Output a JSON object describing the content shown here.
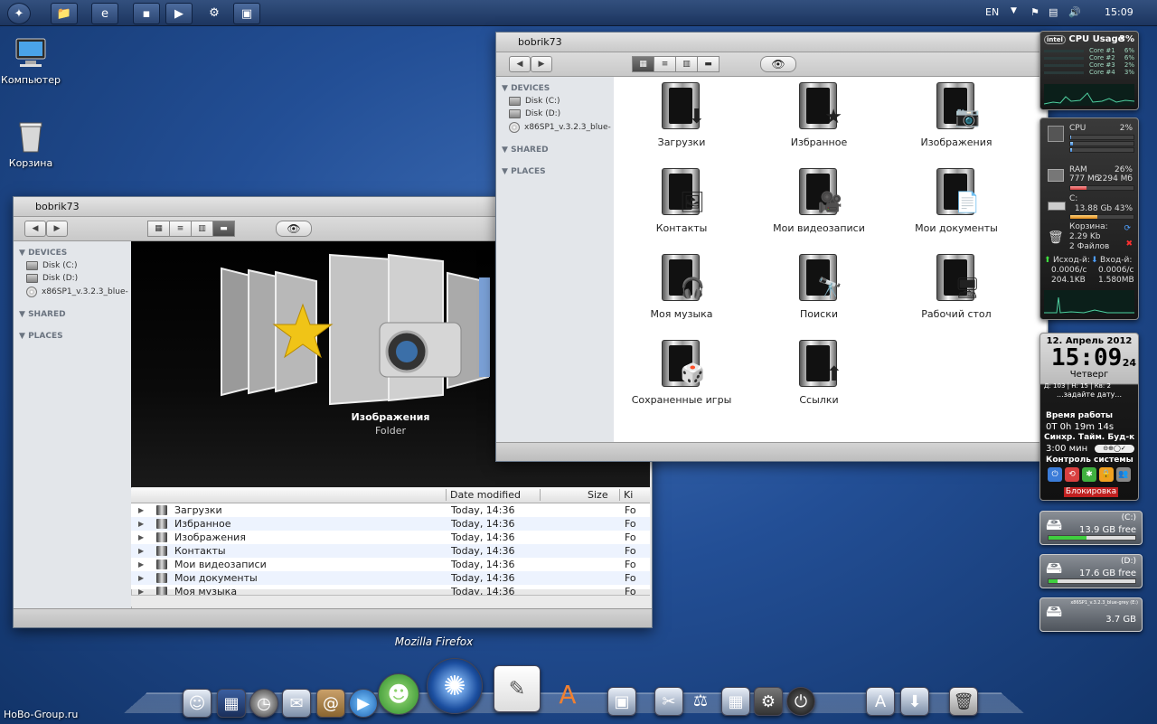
{
  "taskbar": {
    "lang": "EN",
    "clock": "15:09"
  },
  "desktop": {
    "icons": [
      {
        "label": "Компьютер"
      },
      {
        "label": "Корзина"
      }
    ],
    "watermark": "HoBo-Group.ru"
  },
  "window_back": {
    "title": "bobrik73",
    "sidebar": {
      "devices_header": "DEVICES",
      "devices": [
        "Disk (C:)",
        "Disk (D:)",
        "x86SP1_v.3.2.3_blue-"
      ],
      "shared_header": "SHARED",
      "places_header": "PLACES"
    },
    "coverflow": {
      "selected_name": "Изображения",
      "selected_kind": "Folder"
    },
    "list": {
      "columns": [
        "Date modified",
        "Size",
        "Ki"
      ],
      "rows": [
        {
          "name": "Загрузки",
          "date": "Today, 14:36",
          "kind": "Fo"
        },
        {
          "name": "Избранное",
          "date": "Today, 14:36",
          "kind": "Fo"
        },
        {
          "name": "Изображения",
          "date": "Today, 14:36",
          "kind": "Fo"
        },
        {
          "name": "Контакты",
          "date": "Today, 14:36",
          "kind": "Fo"
        },
        {
          "name": "Мои видеозаписи",
          "date": "Today, 14:36",
          "kind": "Fo"
        },
        {
          "name": "Мои документы",
          "date": "Today, 14:36",
          "kind": "Fo"
        },
        {
          "name": "Моя музыка",
          "date": "Today, 14:36",
          "kind": "Fo"
        }
      ]
    }
  },
  "window_front": {
    "title": "bobrik73",
    "sidebar": {
      "devices_header": "DEVICES",
      "devices": [
        "Disk (C:)",
        "Disk (D:)",
        "x86SP1_v.3.2.3_blue-"
      ],
      "shared_header": "SHARED",
      "places_header": "PLACES"
    },
    "folders": [
      {
        "label": "Загрузки",
        "icon": "⬇"
      },
      {
        "label": "Избранное",
        "icon": "★"
      },
      {
        "label": "Изображения",
        "icon": "📷"
      },
      {
        "label": "Контакты",
        "icon": "🖼"
      },
      {
        "label": "Мои видеозаписи",
        "icon": "🎥"
      },
      {
        "label": "Мои документы",
        "icon": "📄"
      },
      {
        "label": "Моя музыка",
        "icon": "🎧"
      },
      {
        "label": "Поиски",
        "icon": "🔭"
      },
      {
        "label": "Рабочий стол",
        "icon": "🖥"
      },
      {
        "label": "Сохраненные игры",
        "icon": "🎲"
      },
      {
        "label": "Ссылки",
        "icon": "⬆"
      }
    ]
  },
  "gadgets": {
    "cpu_usage": {
      "title": "CPU Usage",
      "total": "3%",
      "cores": [
        {
          "label": "Core #1",
          "value": "6%"
        },
        {
          "label": "Core #2",
          "value": "6%"
        },
        {
          "label": "Core #3",
          "value": "2%"
        },
        {
          "label": "Core #4",
          "value": "3%"
        }
      ]
    },
    "system": {
      "cpu_label": "CPU",
      "cpu_value": "2%",
      "ram_label": "RAM",
      "ram_percent": "26%",
      "ram_used": "777 Мб",
      "ram_total": "2294 Мб",
      "c_label": "C:",
      "c_value": "13.88 Gb 43%",
      "bin_label": "Корзина:",
      "bin_size": "2.29 Kb",
      "bin_files": "2 Файлов",
      "out_label": "Исход-й:",
      "in_label": "Вход-й:",
      "out_rate": "0.0006/с",
      "in_rate": "0.0006/с",
      "out_total": "204.1KB",
      "in_total": "1.580MB"
    },
    "clock": {
      "date": "12. Апрель 2012",
      "time": "15:09",
      "seconds": "24",
      "weekday": "Четверг",
      "counters": "Д: 103  |  Н: 15  |  Кв: 2",
      "hint": "...задайте дату...",
      "uptime_label": "Время работы",
      "uptime": "0Т 0h 19m 14s",
      "sync_row": "Синхр.  Тайм.  Буд-к",
      "timer": "3:00 мин",
      "control_label": "Контроль системы",
      "lock_label": "Блокировка"
    },
    "drives": [
      {
        "letter": "(C:)",
        "free": "13.9 GB free",
        "fill": 0.44
      },
      {
        "letter": "(D:)",
        "free": "17.6 GB free",
        "fill": 0.1
      },
      {
        "letter": "x86SP1_v.3.2.3_blue-grey (E:)",
        "free": "3.7 GB",
        "fill": 0.0
      }
    ]
  },
  "dock": {
    "hover_label": "Mozilla Firefox"
  }
}
